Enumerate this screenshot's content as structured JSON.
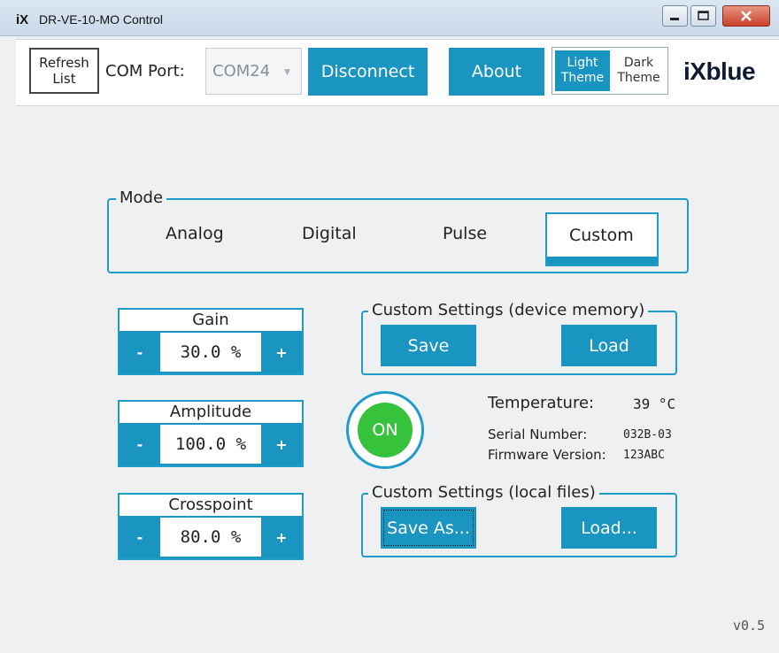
{
  "window": {
    "logo": "iX",
    "title": "DR-VE-10-MO Control"
  },
  "toolbar": {
    "refresh_label_line1": "Refresh",
    "refresh_label_line2": "List",
    "com_port_label": "COM Port:",
    "com_port_value": "COM24",
    "disconnect_label": "Disconnect",
    "about_label": "About",
    "light_theme_line1": "Light",
    "light_theme_line2": "Theme",
    "dark_theme_line1": "Dark",
    "dark_theme_line2": "Theme",
    "brand": "iXblue"
  },
  "mode": {
    "legend": "Mode",
    "options": [
      "Analog",
      "Digital",
      "Pulse",
      "Custom"
    ],
    "selected": "Custom"
  },
  "steppers": [
    {
      "label": "Gain",
      "value": "30.0 %",
      "minus": "-",
      "plus": "+"
    },
    {
      "label": "Amplitude",
      "value": "100.0 %",
      "minus": "-",
      "plus": "+"
    },
    {
      "label": "Crosspoint",
      "value": "80.0 %",
      "minus": "-",
      "plus": "+"
    }
  ],
  "device_memory": {
    "legend": "Custom Settings (device memory)",
    "save_label": "Save",
    "load_label": "Load"
  },
  "status": {
    "on_label": "ON",
    "temperature_label": "Temperature:",
    "temperature_value": "39 °C",
    "serial_label": "Serial Number:",
    "serial_value": "032B-03",
    "firmware_label": "Firmware Version:",
    "firmware_value": "123ABC"
  },
  "local_files": {
    "legend": "Custom Settings (local files)",
    "save_as_label": "Save As...",
    "load_label": "Load..."
  },
  "version": "v0.5",
  "colors": {
    "accent": "#1a95c2",
    "on_indicator": "#36c23a",
    "background": "#eef0f1"
  }
}
